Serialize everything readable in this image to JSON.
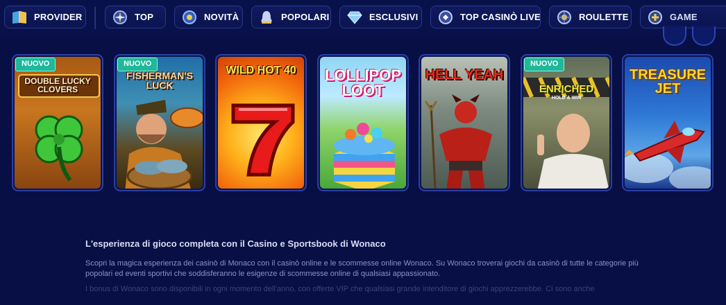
{
  "nav": {
    "items": [
      {
        "label": "PROVIDER",
        "icon": "book-icon"
      },
      {
        "label": "TOP",
        "icon": "compass-icon"
      },
      {
        "label": "NOVITÀ",
        "icon": "new-icon"
      },
      {
        "label": "POPOLARI",
        "icon": "bell-icon"
      },
      {
        "label": "ESCLUSIVI",
        "icon": "diamond-icon"
      },
      {
        "label": "TOP CASINÒ LIVE",
        "icon": "live-icon"
      },
      {
        "label": "ROULETTE",
        "icon": "roulette-icon"
      },
      {
        "label": "GAME",
        "icon": "gamepad-icon"
      }
    ]
  },
  "games": [
    {
      "title": "DOUBLE LUCKY CLOVERS",
      "badge": "NUOVO"
    },
    {
      "title": "FISHERMAN'S LUCK",
      "badge": "NUOVO"
    },
    {
      "title": "WILD HOT 40",
      "badge": ""
    },
    {
      "title": "LOLLIPOP LOOT",
      "badge": ""
    },
    {
      "title": "HELL YEAH",
      "badge": ""
    },
    {
      "title": "ENRICHED",
      "subtitle": "HOLD & WIN",
      "badge": "NUOVO"
    },
    {
      "title": "TREASURE JET",
      "badge": ""
    }
  ],
  "info": {
    "heading": "L'esperienza di gioco completa con il Casino e Sportsbook di Wonaco",
    "paragraph": "Scopri la magica esperienza dei casinò di Monaco con il casinò online e le scommesse online Wonaco. Su Wonaco troverai giochi da casinò di tutte le categorie più popolari ed eventi sportivi che soddisferanno le esigenze di scommesse online di qualsiasi appassionato.",
    "faded": "I bonus di Wonaco sono disponibili in ogni momento dell'anno, con offerte VIP che qualsiasi grande intenditore di giochi apprezzerebbe. Ci sono anche"
  }
}
